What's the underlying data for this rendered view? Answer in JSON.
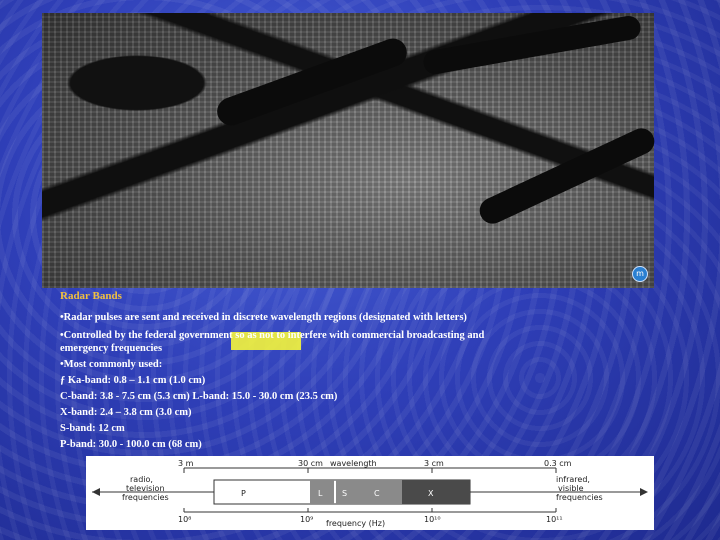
{
  "slide": {
    "title": "Radar Bands",
    "bullets": [
      "•Radar pulses are sent and received in discrete wavelength regions (designated with letters)",
      "•Controlled by the federal government so as not to interfere with commercial broadcasting and",
      "emergency frequencies",
      "•Most commonly used:",
      "ƒ Ka-band: 0.8 – 1.1 cm (1.0 cm)",
      "C-band: 3.8 - 7.5 cm (5.3 cm)  L-band: 15.0 - 30.0 cm (23.5 cm)",
      "X-band: 2.4 – 3.8 cm (3.0 cm)",
      "S-band: 12 cm",
      "P-band: 30.0 - 100.0 cm (68 cm)"
    ]
  },
  "image": {
    "badge_icon": "info-icon",
    "badge_text": "m"
  },
  "spectrum": {
    "wavelength_label": "wavelength",
    "frequency_label": "frequency (Hz)",
    "wavelength_ticks": [
      "3 m",
      "30 cm",
      "3 cm",
      "0.3 cm"
    ],
    "frequency_ticks": [
      "10⁸",
      "10⁹",
      "10¹⁰",
      "10¹¹"
    ],
    "left_label": [
      "radio,",
      "television",
      "frequencies"
    ],
    "right_label": [
      "infrared,",
      "visible",
      "frequencies"
    ],
    "bands": [
      "P",
      "L",
      "S",
      "C",
      "X"
    ]
  },
  "colors": {
    "background": "#2f3fb8",
    "title": "#f0c040",
    "highlight": "#ffff33"
  }
}
